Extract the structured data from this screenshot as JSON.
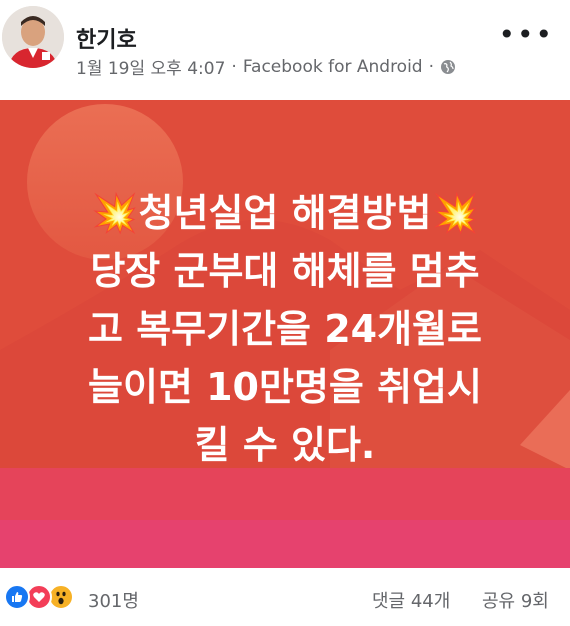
{
  "post": {
    "author": "한기호",
    "timestamp": "1월 19일 오후 4:07",
    "separator": "·",
    "source": "Facebook for Android",
    "privacy_icon": "globe-icon",
    "more_label": "•••"
  },
  "image": {
    "burst_icon": "💥",
    "line1": "청년실업 해결방법",
    "body": "당장 군부대 해체를 멈추\n고 복무기간을 24개월로\n늘이면 10만명을 취업시\n킬 수 있다."
  },
  "reactions": {
    "icons": [
      "like-icon",
      "love-icon",
      "wow-icon"
    ],
    "count": "301명",
    "comments": "댓글 44개",
    "shares": "공유 9회"
  },
  "colors": {
    "like": "#1877f2",
    "love": "#f33e58",
    "wow": "#f7b125",
    "image_bg": "#df4b3a"
  }
}
